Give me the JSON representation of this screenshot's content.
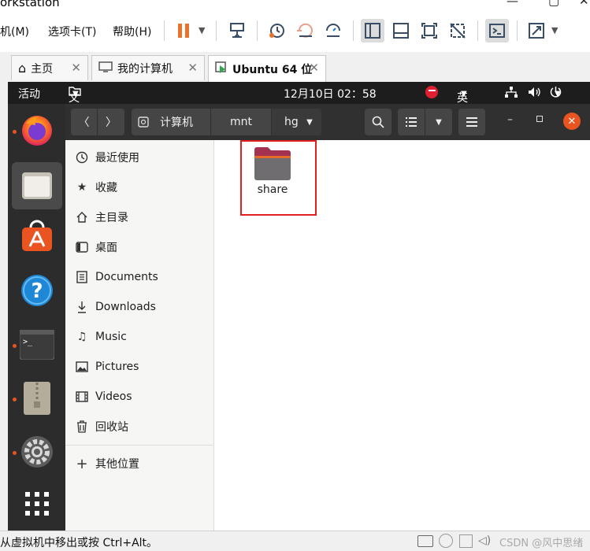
{
  "window": {
    "title": "orkstation"
  },
  "vm_menu": {
    "items": [
      "机(M)",
      "选项卡(T)",
      "帮助(H)"
    ]
  },
  "vm_tabs": [
    {
      "label": "主页",
      "icon": "home-icon"
    },
    {
      "label": "我的计算机",
      "icon": "monitor-icon"
    },
    {
      "label": "Ubuntu 64 位",
      "icon": "vm-running-icon",
      "active": true
    }
  ],
  "topbar": {
    "activities": "活动",
    "files_menu": "文件",
    "clock": "12月10日  02：58",
    "input_method": "英"
  },
  "dock": {
    "items": [
      "firefox-icon",
      "files-icon",
      "software-icon",
      "help-icon",
      "terminal-icon",
      "archive-icon",
      "settings-icon",
      "apps-grid-icon"
    ]
  },
  "pathbar": {
    "segments": [
      "计算机",
      "mnt",
      "hgfs"
    ]
  },
  "sidebar": {
    "items": [
      {
        "label": "最近使用",
        "icon": "recent-icon"
      },
      {
        "label": "收藏",
        "icon": "star-icon"
      },
      {
        "label": "主目录",
        "icon": "home-icon"
      },
      {
        "label": "桌面",
        "icon": "desktop-icon"
      },
      {
        "label": "Documents",
        "icon": "document-icon"
      },
      {
        "label": "Downloads",
        "icon": "download-icon"
      },
      {
        "label": "Music",
        "icon": "music-icon"
      },
      {
        "label": "Pictures",
        "icon": "picture-icon"
      },
      {
        "label": "Videos",
        "icon": "video-icon"
      },
      {
        "label": "回收站",
        "icon": "trash-icon"
      }
    ],
    "other_locations": "其他位置"
  },
  "content": {
    "items": [
      {
        "name": "share",
        "type": "folder"
      }
    ]
  },
  "statusbar": {
    "text": "从虚拟机中移出或按 Ctrl+Alt。",
    "watermark": "CSDN @风中思绪"
  },
  "colors": {
    "ubuntu_orange": "#e95420",
    "highlight": "#e02020",
    "vm_pause": "#e8732a"
  }
}
